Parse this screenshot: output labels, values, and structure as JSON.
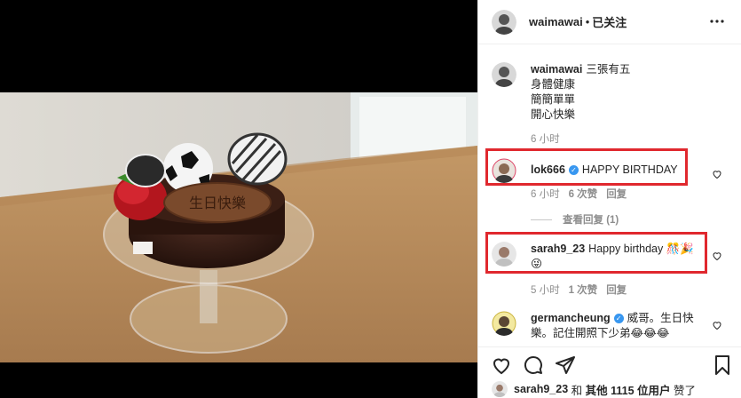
{
  "post": {
    "author": "waimawai",
    "separator": "•",
    "follow_status": "已关注"
  },
  "caption": {
    "username": "waimawai",
    "lines": [
      "三張有五",
      "身體健康",
      "簡簡單單",
      "開心快樂"
    ],
    "time": "6 小时"
  },
  "comments": [
    {
      "username": "lok666",
      "verified": true,
      "text": "HAPPY BIRTHDAY",
      "time": "6 小时",
      "likes": "6 次赞",
      "reply": "回复",
      "view_replies": "查看回复 (1)"
    },
    {
      "username": "sarah9_23",
      "verified": false,
      "text": "Happy birthday",
      "emoji": "🎊🎉",
      "emoji2": "😜",
      "time": "5 小时",
      "likes": "1 次赞",
      "reply": "回复"
    },
    {
      "username": "germancheung",
      "verified": true,
      "text_line1": "威哥。生日快",
      "text_line2": "樂。記住開照下少弟",
      "emoji": "😂😂😂"
    }
  ],
  "likes_bar": {
    "liker": "sarah9_23",
    "and": "和",
    "others": "其他 1115 位用户",
    "action": "赞了"
  },
  "icons": {
    "more": "more-icon",
    "heart": "heart-icon",
    "like": "like-icon",
    "comment": "comment-icon",
    "share": "share-icon",
    "save": "bookmark-icon"
  },
  "colors": {
    "highlight": "#e0282e",
    "verified": "#3897f0",
    "muted": "#8e8e8e",
    "text": "#262626"
  }
}
